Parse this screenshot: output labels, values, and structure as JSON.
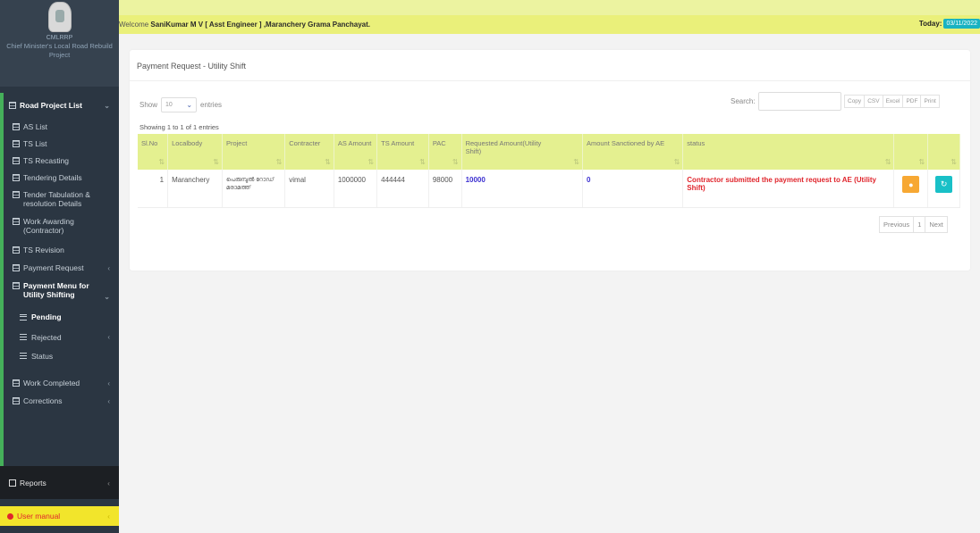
{
  "brand": {
    "abbr": "CMLRRP",
    "name": "Chief Minister's Local Road Rebuild Project"
  },
  "menu": {
    "road_project_list": "Road Project List",
    "items": [
      "AS List",
      "TS List",
      "TS Recasting",
      "Tendering Details",
      "Tender Tabulation & resolution Details",
      "Work Awarding (Contractor)",
      "TS Revision",
      "Payment Request",
      "Payment Menu for Utility Shifting"
    ],
    "sub_items": [
      "Pending",
      "Rejected",
      "Status"
    ],
    "after_items": [
      "Work Completed",
      "Corrections"
    ],
    "reports": "Reports",
    "user_manual": "User manual"
  },
  "header": {
    "welcome_prefix": "Welcome ",
    "welcome_name": "SaniKumar M V  [ Asst Engineer ] ,Maranchery Grama Panchayat.",
    "today_label": "Today:",
    "today_date": "03/11/2022"
  },
  "page": {
    "title": "Payment Request - Utility Shift",
    "show_label": "Show",
    "entries_value": "10",
    "entries_label": "entries",
    "search_label": "Search:",
    "export_buttons": [
      "Copy",
      "CSV",
      "Excel",
      "PDF",
      "Print"
    ],
    "showing_text": "Showing 1 to 1 of 1 entries"
  },
  "table": {
    "headers": [
      "Sl.No",
      "Localbody",
      "Project",
      "Contracter",
      "AS Amount",
      "TS Amount",
      "PAC",
      "Requested Amount(Utility Shift)",
      "Amount Sanctioned by AE",
      "status",
      "",
      ""
    ],
    "rows": [
      {
        "sl": "1",
        "localbody": "Maranchery",
        "project": "പെരുമ്പുൽ റോഡ് മരാമത്ത്",
        "contracter": "vimal",
        "as_amount": "1000000",
        "ts_amount": "444444",
        "pac": "98000",
        "requested": "10000",
        "sanctioned": "0",
        "status": "Contractor submitted the payment request to AE (Utility Shift)"
      }
    ]
  },
  "pager": {
    "previous": "Previous",
    "page": "1",
    "next": "Next"
  },
  "colors": {
    "sidebar": "#2b3642",
    "header_yellow": "#eaf07a",
    "table_header": "#e4f090",
    "status_red": "#e0252c",
    "link_blue": "#3b2fd0",
    "action_orange": "#f7a833",
    "action_teal": "#19c0c7"
  }
}
